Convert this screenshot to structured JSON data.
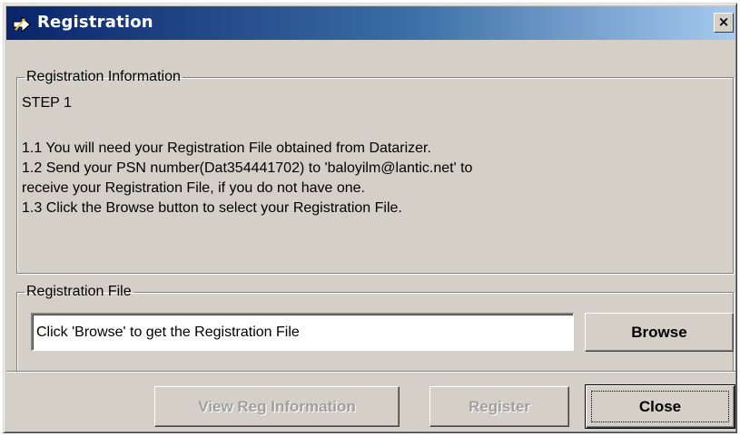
{
  "window": {
    "title": "Registration",
    "icon": "pen-arrow-icon",
    "close_glyph": "×",
    "accent_color": "#0a246a"
  },
  "info_group": {
    "legend": "Registration Information",
    "step": "STEP 1",
    "lines": [
      "1.1  You will need your Registration File obtained from Datarizer.",
      "1.2  Send your PSN number(Dat354441702) to 'baloyilm@lantic.net' to",
      "receive your Registration File, if you do not have one.",
      "1.3  Click the Browse button to select your Registration File."
    ]
  },
  "file_group": {
    "legend": "Registration File",
    "input_value": "Click 'Browse' to get the Registration File",
    "browse_label": "Browse"
  },
  "footer": {
    "view_label": "View Reg Information",
    "register_label": "Register",
    "close_label": "Close"
  }
}
